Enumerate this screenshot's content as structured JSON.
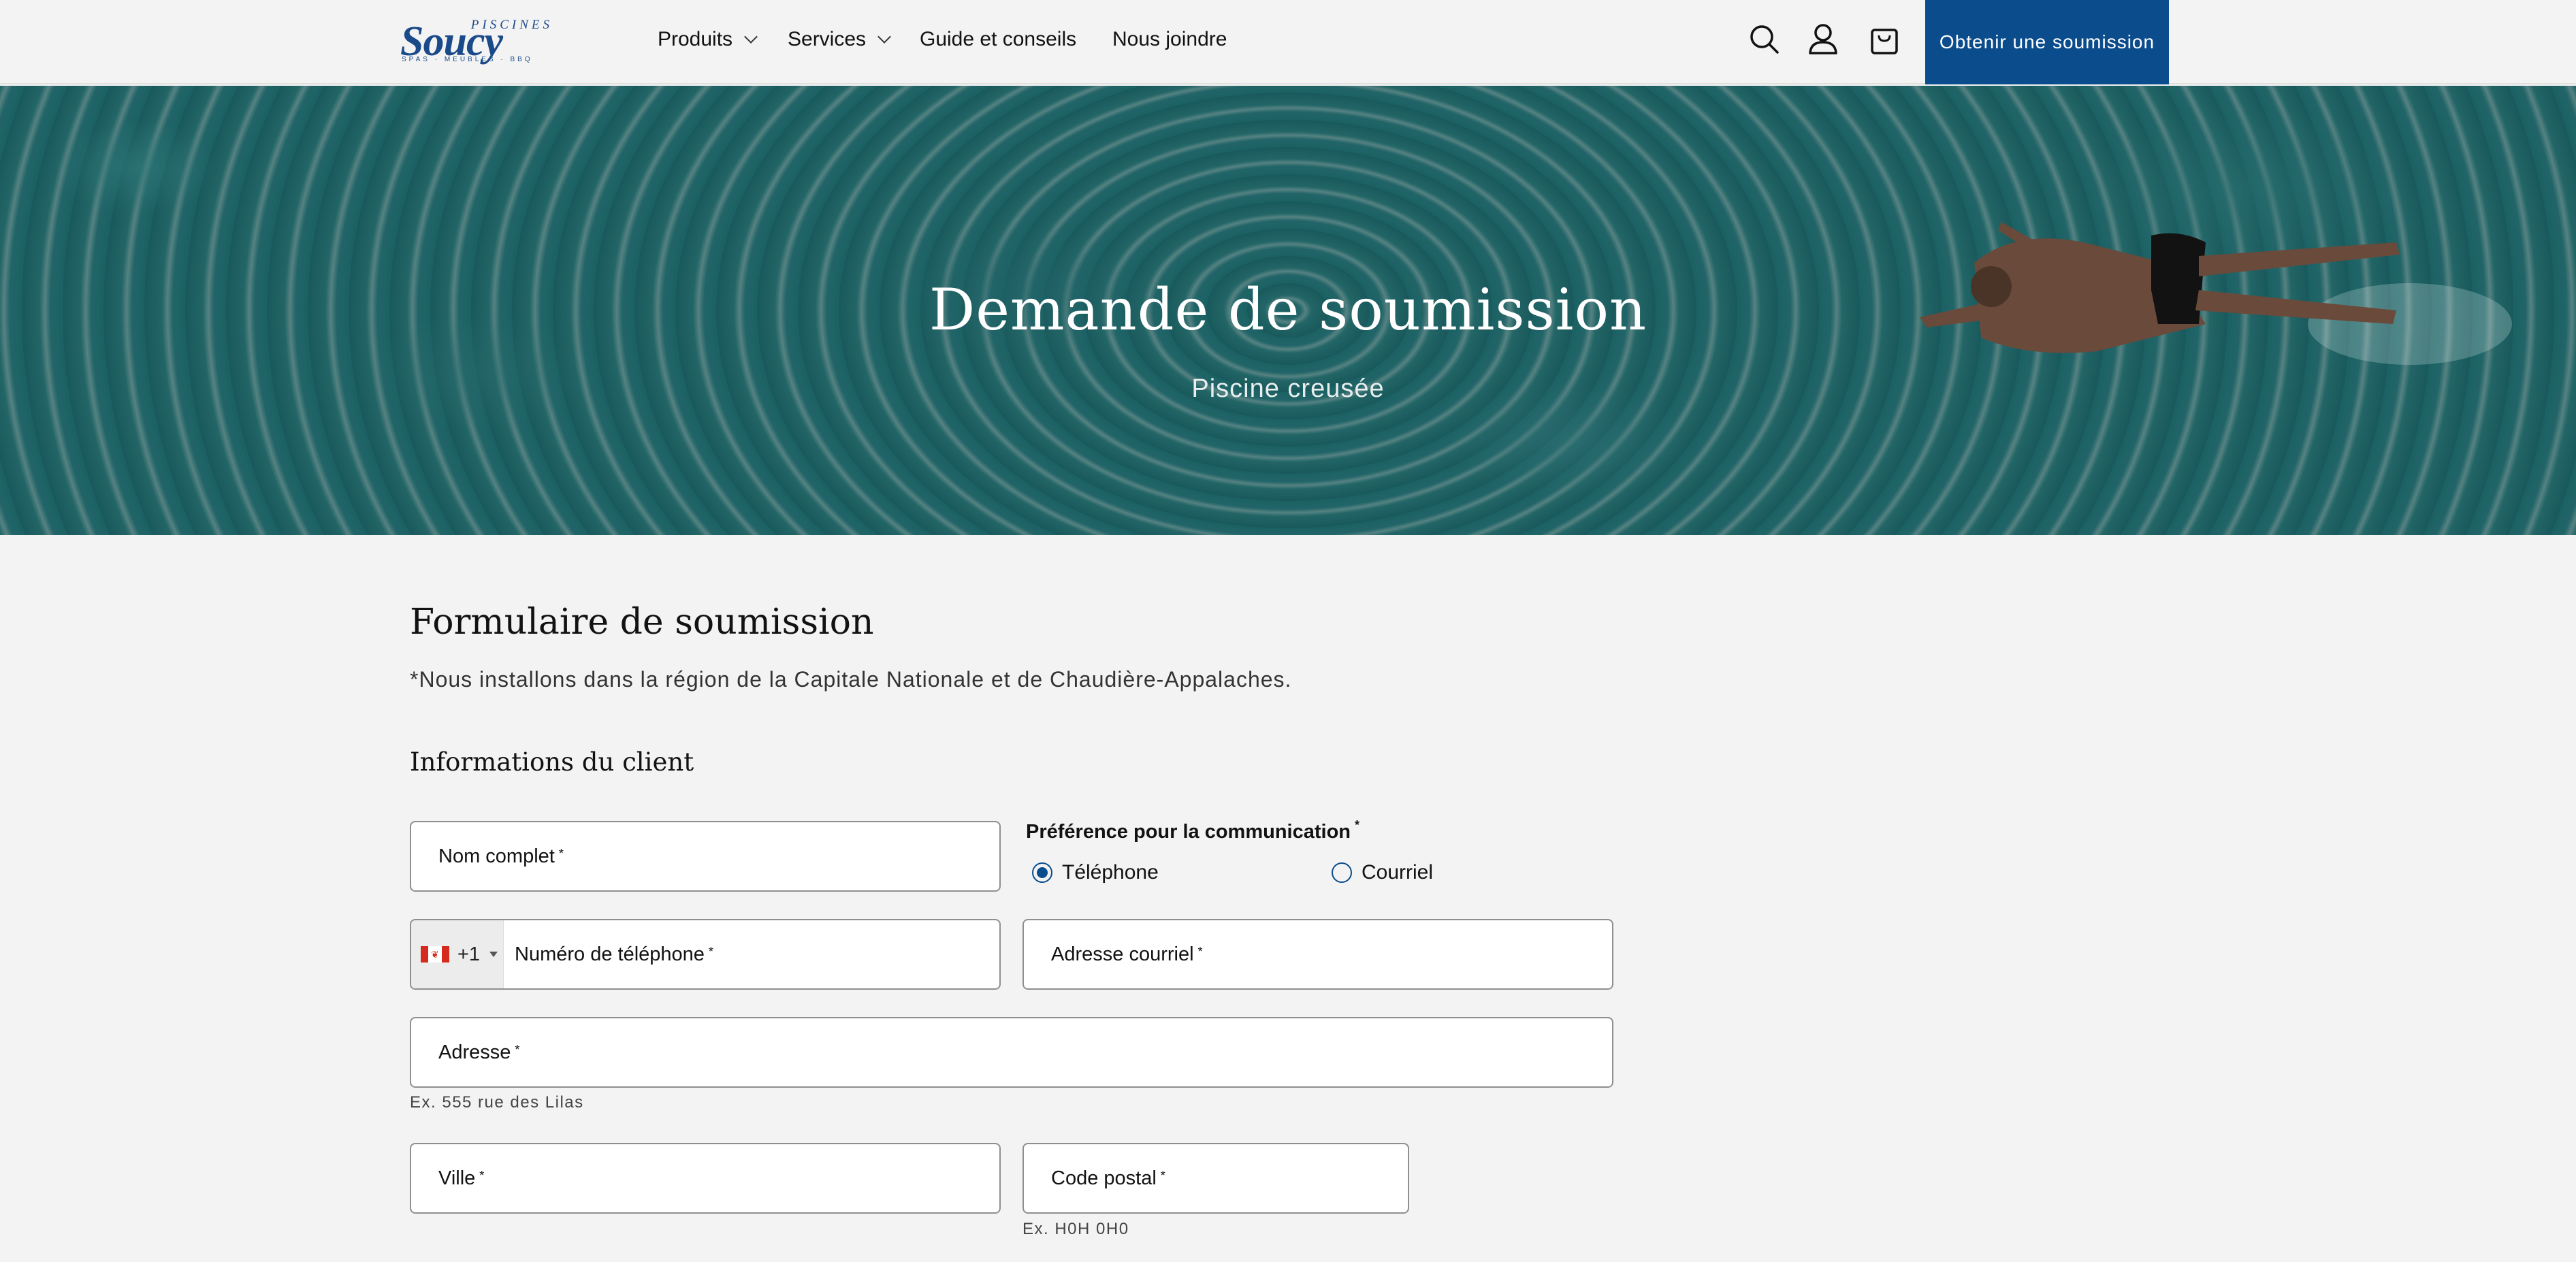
{
  "header": {
    "logo": {
      "top": "PISCINES",
      "main": "Soucy",
      "sub": "SPAS · MEUBLES · BBQ"
    },
    "nav": [
      {
        "label": "Produits",
        "has_dropdown": true
      },
      {
        "label": "Services",
        "has_dropdown": true
      },
      {
        "label": "Guide et conseils",
        "has_dropdown": false
      },
      {
        "label": "Nous joindre",
        "has_dropdown": false
      }
    ],
    "icons": [
      "search-icon",
      "account-icon",
      "cart-icon"
    ],
    "cta_label": "Obtenir une soumission",
    "cta_color": "#0b4c8c"
  },
  "hero": {
    "title": "Demande de soumission",
    "subtitle": "Piscine creusée"
  },
  "form": {
    "title": "Formulaire de soumission",
    "note": "*Nous installons dans la région de la Capitale Nationale et de Chaudière-Appalaches.",
    "section_title": "Informations du client",
    "required_mark": "*",
    "fields": {
      "name": {
        "label": "Nom complet"
      },
      "phone": {
        "country_code": "+1",
        "label": "Numéro de téléphone"
      },
      "email": {
        "label": "Adresse courriel"
      },
      "address": {
        "label": "Adresse",
        "help": "Ex. 555 rue des Lilas"
      },
      "city": {
        "label": "Ville"
      },
      "postal": {
        "label": "Code postal",
        "help": "Ex. H0H 0H0"
      }
    },
    "communication": {
      "label": "Préférence pour la communication",
      "options": [
        {
          "label": "Téléphone",
          "selected": true
        },
        {
          "label": "Courriel",
          "selected": false
        }
      ]
    }
  }
}
